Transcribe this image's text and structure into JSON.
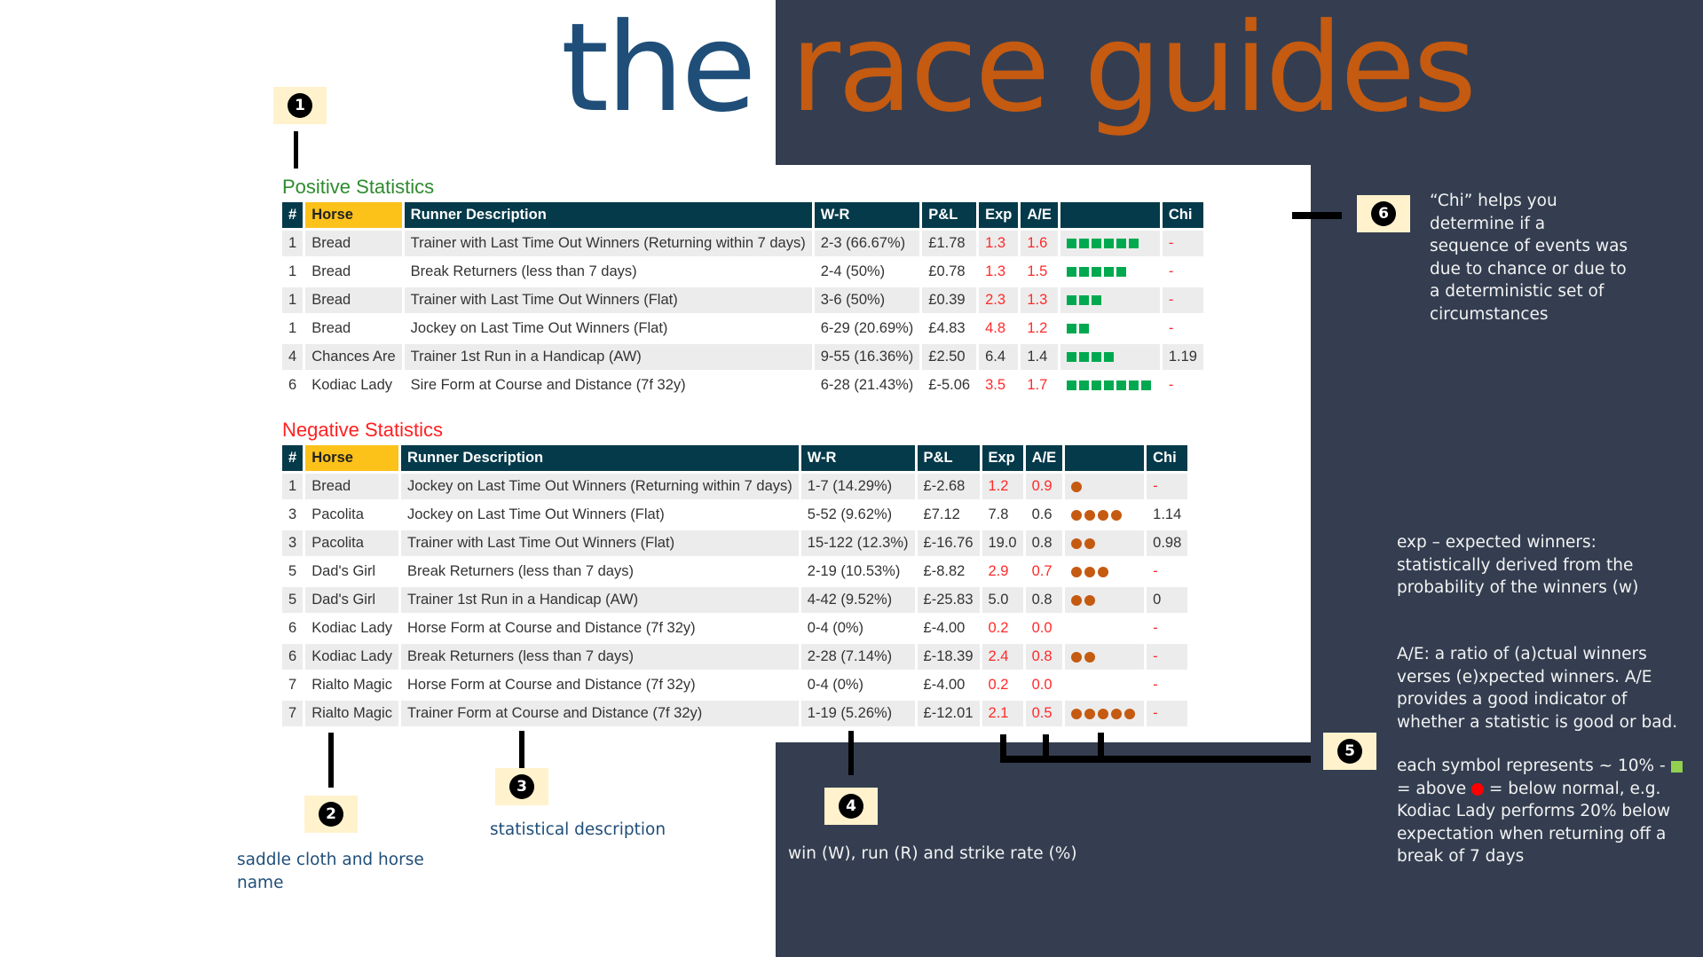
{
  "title": {
    "part1": "the",
    "part2": "race guides"
  },
  "colors": {
    "panel": "#343e50",
    "header": "#053a4a",
    "horse_header": "#fdc21a",
    "positive": "#00a94f",
    "negative": "#c55a11",
    "red_value": "#ff2a2a"
  },
  "positive": {
    "label": "Positive Statistics",
    "headers": [
      "#",
      "Horse",
      "Runner Description",
      "W-R",
      "P&L",
      "Exp",
      "A/E",
      "",
      "Chi"
    ],
    "rows": [
      {
        "no": "1",
        "horse": "Bread",
        "desc": "Trainer with Last Time Out Winners (Returning within 7 days)",
        "wr": "2-3 (66.67%)",
        "pl": "£1.78",
        "exp": "1.3",
        "ae": "1.6",
        "symbols": 6,
        "chi": "-",
        "red": true
      },
      {
        "no": "1",
        "horse": "Bread",
        "desc": "Break Returners (less than 7 days)",
        "wr": "2-4 (50%)",
        "pl": "£0.78",
        "exp": "1.3",
        "ae": "1.5",
        "symbols": 5,
        "chi": "-",
        "red": true
      },
      {
        "no": "1",
        "horse": "Bread",
        "desc": "Trainer with Last Time Out Winners (Flat)",
        "wr": "3-6 (50%)",
        "pl": "£0.39",
        "exp": "2.3",
        "ae": "1.3",
        "symbols": 3,
        "chi": "-",
        "red": true
      },
      {
        "no": "1",
        "horse": "Bread",
        "desc": "Jockey on Last Time Out Winners (Flat)",
        "wr": "6-29 (20.69%)",
        "pl": "£4.83",
        "exp": "4.8",
        "ae": "1.2",
        "symbols": 2,
        "chi": "-",
        "red": true
      },
      {
        "no": "4",
        "horse": "Chances Are",
        "desc": "Trainer 1st Run in a Handicap (AW)",
        "wr": "9-55 (16.36%)",
        "pl": "£2.50",
        "exp": "6.4",
        "ae": "1.4",
        "symbols": 4,
        "chi": "1.19",
        "red": false
      },
      {
        "no": "6",
        "horse": "Kodiac Lady",
        "desc": "Sire Form at Course and Distance (7f 32y)",
        "wr": "6-28 (21.43%)",
        "pl": "£-5.06",
        "exp": "3.5",
        "ae": "1.7",
        "symbols": 7,
        "chi": "-",
        "red": true
      }
    ]
  },
  "negative": {
    "label": "Negative Statistics",
    "headers": [
      "#",
      "Horse",
      "Runner Description",
      "W-R",
      "P&L",
      "Exp",
      "A/E",
      "",
      "Chi"
    ],
    "rows": [
      {
        "no": "1",
        "horse": "Bread",
        "desc": "Jockey on Last Time Out Winners (Returning within 7 days)",
        "wr": "1-7 (14.29%)",
        "pl": "£-2.68",
        "exp": "1.2",
        "ae": "0.9",
        "symbols": 1,
        "chi": "-",
        "red": true
      },
      {
        "no": "3",
        "horse": "Pacolita",
        "desc": "Jockey on Last Time Out Winners (Flat)",
        "wr": "5-52 (9.62%)",
        "pl": "£7.12",
        "exp": "7.8",
        "ae": "0.6",
        "symbols": 4,
        "chi": "1.14",
        "red": false
      },
      {
        "no": "3",
        "horse": "Pacolita",
        "desc": "Trainer with Last Time Out Winners (Flat)",
        "wr": "15-122 (12.3%)",
        "pl": "£-16.76",
        "exp": "19.0",
        "ae": "0.8",
        "symbols": 2,
        "chi": "0.98",
        "red": false
      },
      {
        "no": "5",
        "horse": "Dad's Girl",
        "desc": "Break Returners (less than 7 days)",
        "wr": "2-19 (10.53%)",
        "pl": "£-8.82",
        "exp": "2.9",
        "ae": "0.7",
        "symbols": 3,
        "chi": "-",
        "red": true
      },
      {
        "no": "5",
        "horse": "Dad's Girl",
        "desc": "Trainer 1st Run in a Handicap (AW)",
        "wr": "4-42 (9.52%)",
        "pl": "£-25.83",
        "exp": "5.0",
        "ae": "0.8",
        "symbols": 2,
        "chi": "0",
        "red": false
      },
      {
        "no": "6",
        "horse": "Kodiac Lady",
        "desc": "Horse Form at Course and Distance (7f 32y)",
        "wr": "0-4 (0%)",
        "pl": "£-4.00",
        "exp": "0.2",
        "ae": "0.0",
        "symbols": 0,
        "chi": "-",
        "red": true
      },
      {
        "no": "6",
        "horse": "Kodiac Lady",
        "desc": "Break Returners (less than 7 days)",
        "wr": "2-28 (7.14%)",
        "pl": "£-18.39",
        "exp": "2.4",
        "ae": "0.8",
        "symbols": 2,
        "chi": "-",
        "red": true
      },
      {
        "no": "7",
        "horse": "Rialto Magic",
        "desc": "Horse Form at Course and Distance (7f 32y)",
        "wr": "0-4 (0%)",
        "pl": "£-4.00",
        "exp": "0.2",
        "ae": "0.0",
        "symbols": 0,
        "chi": "-",
        "red": true
      },
      {
        "no": "7",
        "horse": "Rialto Magic",
        "desc": "Trainer Form at Course and Distance (7f 32y)",
        "wr": "1-19 (5.26%)",
        "pl": "£-12.01",
        "exp": "2.1",
        "ae": "0.5",
        "symbols": 5,
        "chi": "-",
        "red": true
      }
    ]
  },
  "callouts": {
    "c1": "1",
    "c2": "2",
    "c3": "3",
    "c4": "4",
    "c5": "5",
    "c6": "6",
    "note2": "saddle cloth and horse name",
    "note3": "statistical description",
    "note4": "win (W), run (R) and strike rate (%)",
    "note6": "“Chi” helps you determine if a sequence of events was due to chance or due to a deterministic set of circumstances",
    "note_exp": "exp – expected winners: statistically derived from the probability of the winners (w)",
    "note_ae": "A/E: a ratio of (a)ctual winners verses (e)xpected winners. A/E provides a good indicator of whether a statistic is good or bad.",
    "note_sym_1": "each symbol represents ~ 10% -",
    "note_sym_2": "= above",
    "note_sym_3": "= below  normal, e.g. Kodiac Lady performs 20% below expectation when returning off a break of 7 days"
  }
}
